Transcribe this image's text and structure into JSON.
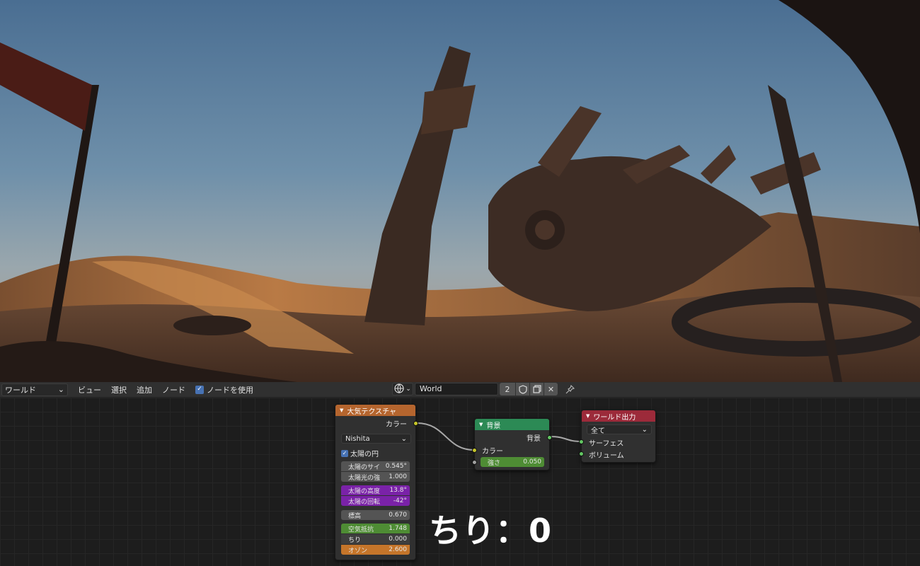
{
  "header": {
    "editor_type": "ワールド",
    "menu": [
      "ビュー",
      "選択",
      "追加",
      "ノード"
    ],
    "use_nodes_label": "ノードを使用",
    "use_nodes_checked": true,
    "world_name": "World",
    "user_count": "2"
  },
  "nodes": {
    "sky": {
      "title": "大気テクスチャ",
      "output_color": "カラー",
      "sky_type": "Nishita",
      "sun_disc_label": "太陽の円",
      "sun_disc_checked": true,
      "sun_size_label": "太陽のサイ",
      "sun_size_value": "0.545°",
      "sun_intensity_label": "太陽光の強",
      "sun_intensity_value": "1.000",
      "sun_elevation_label": "太陽の高度",
      "sun_elevation_value": "13.8°",
      "sun_rotation_label": "太陽の回転",
      "sun_rotation_value": "-42°",
      "altitude_label": "標高",
      "altitude_value": "0.670",
      "air_label": "空気抵抗",
      "air_value": "1.748",
      "dust_label": "ちり",
      "dust_value": "0.000",
      "ozone_label": "オゾン",
      "ozone_value": "2.600"
    },
    "background": {
      "title": "背景",
      "output_label": "背景",
      "input_color": "カラー",
      "strength_label": "強さ",
      "strength_value": "0.050"
    },
    "world_output": {
      "title": "ワールド出力",
      "target": "全て",
      "surface_label": "サーフェス",
      "volume_label": "ボリューム"
    }
  },
  "caption": "ちり：0",
  "colors": {
    "sky_header": "#b5652e",
    "background_header": "#2c8a55",
    "output_header": "#9c2a3a",
    "purple_field": "#7a22a8",
    "green_field": "#4e8c34",
    "orange_field": "#c5752a"
  }
}
